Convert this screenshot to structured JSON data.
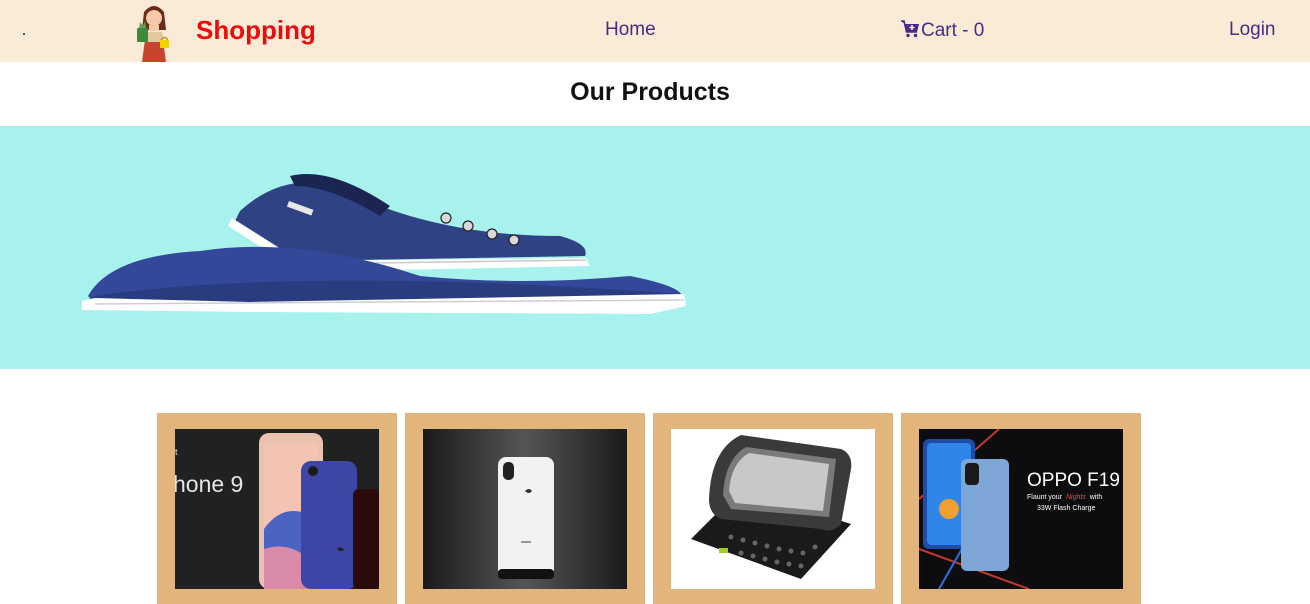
{
  "nav": {
    "brand": "Shopping",
    "home_label": "Home",
    "cart_label": "Cart - 0",
    "login_label": "Login",
    "logo_icon": "girl-with-shopping-bag-icon",
    "cart_icon": "cart-plus-icon",
    "background": "#f9ebd6",
    "brand_color": "#ee0a0a",
    "link_color": "#4a2a86"
  },
  "main": {
    "title": "Our Products"
  },
  "banner": {
    "background": "#a7f2ec",
    "image": "blue-canvas-sneakers"
  },
  "products": [
    {
      "image": "iphone-8-product-shot",
      "image_text": "hone 9"
    },
    {
      "image": "silver-iphone-back"
    },
    {
      "image": "slider-keyboard-phone"
    },
    {
      "image": "oppo-f19-promo",
      "title": "OPPO F19",
      "tagline_start": "Flaunt your",
      "tagline_script": "Nights",
      "tagline_end": "with",
      "charge": "33W Flash Charge"
    }
  ],
  "colors": {
    "card": "#e1b57b"
  }
}
